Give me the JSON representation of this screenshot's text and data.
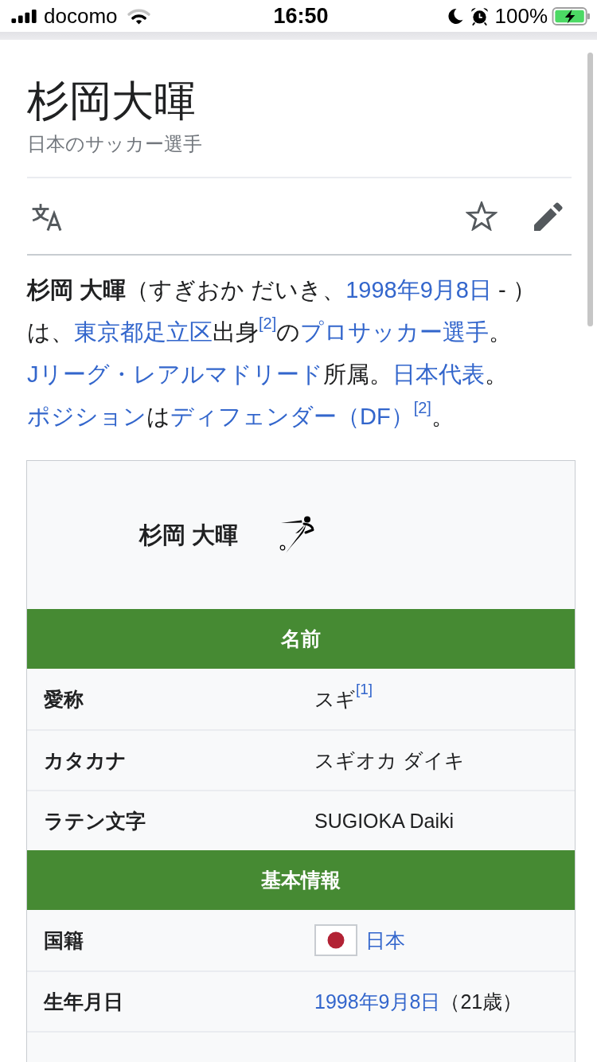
{
  "status_bar": {
    "carrier": "docomo",
    "time": "16:50",
    "battery": "100%"
  },
  "page": {
    "title": "杉岡大暉",
    "description": "日本のサッカー選手"
  },
  "lead": [
    {
      "kind": "bold",
      "text": "杉岡 大暉"
    },
    {
      "kind": "plain",
      "text": "（すぎおか だいき、"
    },
    {
      "kind": "link",
      "text": "1998年9月8日"
    },
    {
      "kind": "plain",
      "text": " - ）は、"
    },
    {
      "kind": "link",
      "text": "東京都足立区"
    },
    {
      "kind": "plain",
      "text": "出身"
    },
    {
      "kind": "ref",
      "text": "[2]"
    },
    {
      "kind": "plain",
      "text": "の"
    },
    {
      "kind": "link",
      "text": "プロサッカー選手"
    },
    {
      "kind": "plain",
      "text": "。"
    },
    {
      "kind": "link",
      "text": "Jリーグ・レアルマドリード"
    },
    {
      "kind": "plain",
      "text": "所属。"
    },
    {
      "kind": "link",
      "text": "日本代表"
    },
    {
      "kind": "plain",
      "text": "。"
    },
    {
      "kind": "link",
      "text": "ポジション"
    },
    {
      "kind": "plain",
      "text": "は"
    },
    {
      "kind": "link",
      "text": "ディフェンダー（DF）"
    },
    {
      "kind": "ref",
      "text": "[2]"
    },
    {
      "kind": "plain",
      "text": "。"
    }
  ],
  "infobox": {
    "name": "杉岡 大暉",
    "sections": [
      {
        "heading": "名前",
        "rows": [
          {
            "label": "愛称",
            "value": [
              {
                "kind": "plain",
                "text": "スギ"
              },
              {
                "kind": "ref",
                "text": "[1]"
              }
            ]
          },
          {
            "label": "カタカナ",
            "value": [
              {
                "kind": "plain",
                "text": "スギオカ ダイキ"
              }
            ]
          },
          {
            "label": "ラテン文字",
            "value": [
              {
                "kind": "plain",
                "text": "SUGIOKA Daiki"
              }
            ]
          }
        ]
      },
      {
        "heading": "基本情報",
        "rows": [
          {
            "label": "国籍",
            "value": [
              {
                "kind": "flag"
              },
              {
                "kind": "link",
                "text": "日本"
              }
            ]
          },
          {
            "label": "生年月日",
            "value": [
              {
                "kind": "link",
                "text": "1998年9月8日"
              },
              {
                "kind": "plain",
                "text": "（21歳）"
              }
            ]
          }
        ]
      }
    ]
  }
}
